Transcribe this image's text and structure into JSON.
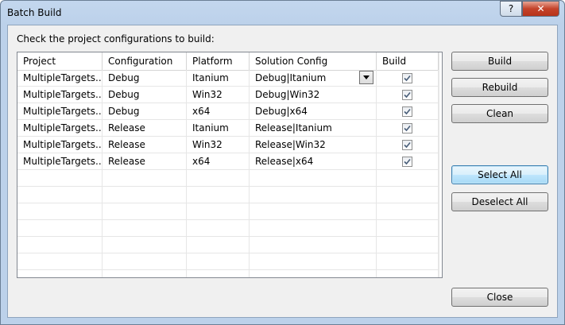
{
  "window": {
    "title": "Batch Build",
    "help_label": "?",
    "close_label": "✕"
  },
  "instruction": "Check the project configurations to build:",
  "columns": [
    "Project",
    "Configuration",
    "Platform",
    "Solution Config",
    "Build"
  ],
  "rows": [
    {
      "project": "MultipleTargets...",
      "configuration": "Debug",
      "platform": "Itanium",
      "solution_config": "Debug|Itanium",
      "build": true
    },
    {
      "project": "MultipleTargets...",
      "configuration": "Debug",
      "platform": "Win32",
      "solution_config": "Debug|Win32",
      "build": true
    },
    {
      "project": "MultipleTargets...",
      "configuration": "Debug",
      "platform": "x64",
      "solution_config": "Debug|x64",
      "build": true
    },
    {
      "project": "MultipleTargets...",
      "configuration": "Release",
      "platform": "Itanium",
      "solution_config": "Release|Itanium",
      "build": true
    },
    {
      "project": "MultipleTargets...",
      "configuration": "Release",
      "platform": "Win32",
      "solution_config": "Release|Win32",
      "build": true
    },
    {
      "project": "MultipleTargets...",
      "configuration": "Release",
      "platform": "x64",
      "solution_config": "Release|x64",
      "build": true
    }
  ],
  "buttons": {
    "build": "Build",
    "rebuild": "Rebuild",
    "clean": "Clean",
    "select_all": "Select All",
    "deselect_all": "Deselect All",
    "close": "Close"
  }
}
